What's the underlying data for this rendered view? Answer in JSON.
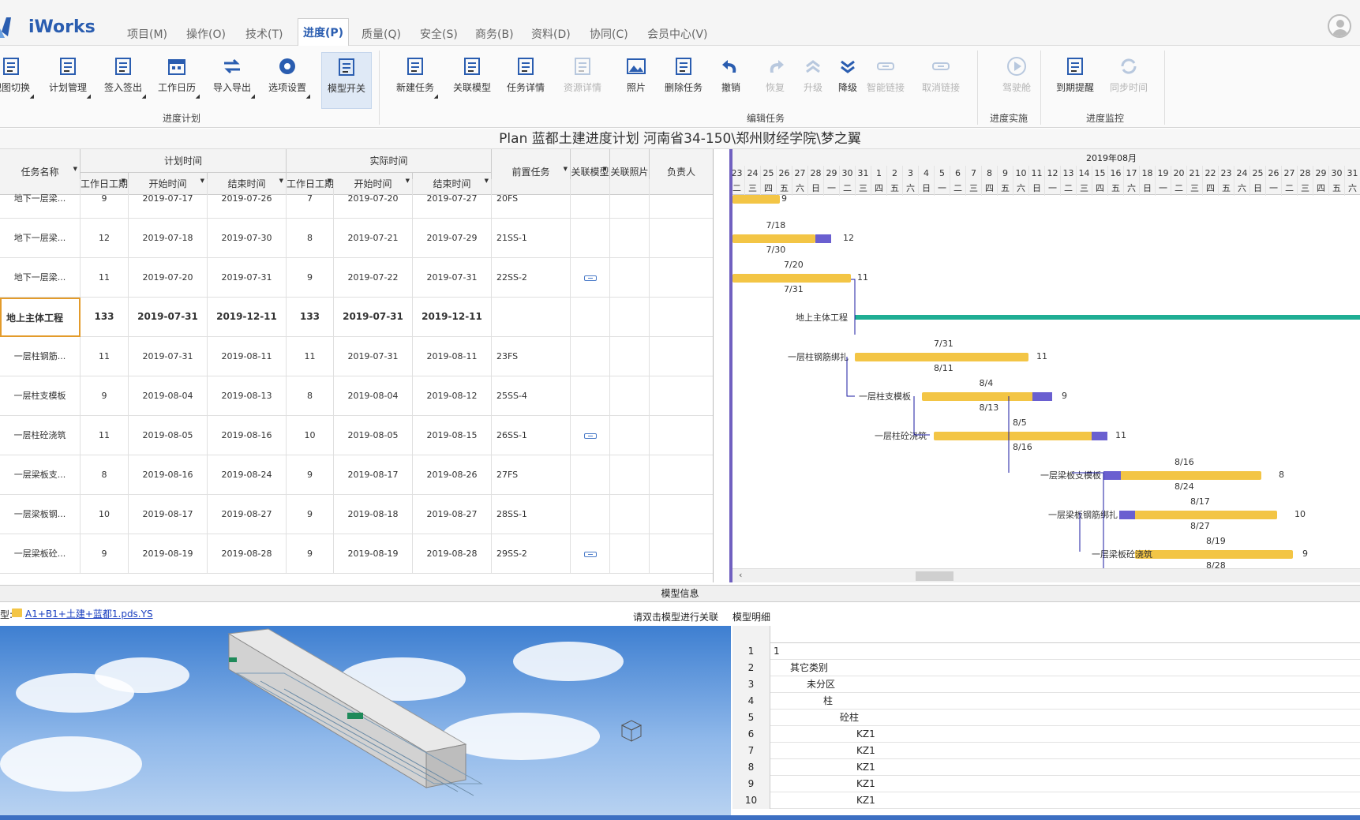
{
  "app": {
    "name": "iWorks"
  },
  "menu": [
    {
      "label": "项目(M)",
      "active": false
    },
    {
      "label": "操作(O)",
      "active": false
    },
    {
      "label": "技术(T)",
      "active": false
    },
    {
      "label": "进度(P)",
      "active": true
    },
    {
      "label": "质量(Q)",
      "active": false
    },
    {
      "label": "安全(S)",
      "active": false
    },
    {
      "label": "商务(B)",
      "active": false
    },
    {
      "label": "资料(D)",
      "active": false
    },
    {
      "label": "协同(C)",
      "active": false
    },
    {
      "label": "会员中心(V)",
      "active": false
    }
  ],
  "ribbon": {
    "groups": [
      {
        "label": "进度计划",
        "buttons": [
          {
            "label": "视图切换",
            "icon": "view-switch-icon",
            "enabled": true,
            "dropdown": true
          },
          {
            "label": "计划管理",
            "icon": "plan-manage-icon",
            "enabled": true,
            "dropdown": true
          },
          {
            "label": "签入签出",
            "icon": "checkin-icon",
            "enabled": true,
            "dropdown": true
          },
          {
            "label": "工作日历",
            "icon": "calendar-icon",
            "enabled": true,
            "dropdown": true
          },
          {
            "label": "导入导出",
            "icon": "import-export-icon",
            "enabled": true,
            "dropdown": true
          },
          {
            "label": "选项设置",
            "icon": "gear-icon",
            "enabled": true,
            "dropdown": true
          },
          {
            "label": "模型开关",
            "icon": "model-switch-icon",
            "enabled": true,
            "dropdown": false,
            "pressed": true
          }
        ]
      },
      {
        "label": "编辑任务",
        "buttons": [
          {
            "label": "新建任务",
            "icon": "new-task-icon",
            "enabled": true,
            "dropdown": true
          },
          {
            "label": "关联模型",
            "icon": "link-model-icon",
            "enabled": true,
            "dropdown": false
          },
          {
            "label": "任务详情",
            "icon": "task-detail-icon",
            "enabled": true,
            "dropdown": false
          },
          {
            "label": "资源详情",
            "icon": "resource-detail-icon",
            "enabled": false,
            "dropdown": false
          },
          {
            "label": "照片",
            "icon": "photo-icon",
            "enabled": true,
            "dropdown": false
          },
          {
            "label": "删除任务",
            "icon": "delete-task-icon",
            "enabled": true,
            "dropdown": false
          },
          {
            "label": "撤销",
            "icon": "undo-icon",
            "enabled": true,
            "dropdown": false
          },
          {
            "label": "恢复",
            "icon": "redo-icon",
            "enabled": false,
            "dropdown": false
          },
          {
            "label": "升级",
            "icon": "upgrade-icon",
            "enabled": false,
            "dropdown": false
          },
          {
            "label": "降级",
            "icon": "downgrade-icon",
            "enabled": true,
            "dropdown": false
          },
          {
            "label": "智能链接",
            "icon": "smart-link-icon",
            "enabled": false,
            "dropdown": false
          },
          {
            "label": "取消链接",
            "icon": "unlink-icon",
            "enabled": false,
            "dropdown": false
          }
        ]
      },
      {
        "label": "进度实施",
        "buttons": [
          {
            "label": "驾驶舱",
            "icon": "play-icon",
            "enabled": false,
            "dropdown": false
          }
        ]
      },
      {
        "label": "进度监控",
        "buttons": [
          {
            "label": "到期提醒",
            "icon": "reminder-icon",
            "enabled": true,
            "dropdown": false
          },
          {
            "label": "同步时间",
            "icon": "sync-icon",
            "enabled": false,
            "dropdown": false
          }
        ]
      }
    ]
  },
  "plan_title": "Plan 蓝都土建进度计划 河南省34-150\\郑州财经学院\\梦之翼",
  "grid": {
    "headers": {
      "task_name": "任务名称",
      "plan_group": "计划时间",
      "actual_group": "实际时间",
      "workdays": "工作日工期",
      "start": "开始时间",
      "end": "结束时间",
      "predecessor": "前置任务",
      "linked_model": "关联模型",
      "linked_photo": "关联照片",
      "owner": "负责人"
    },
    "rows": [
      {
        "name": "地下一层梁...",
        "plan_days": "9",
        "plan_start": "2019-07-17",
        "plan_end": "2019-07-26",
        "act_days": "7",
        "act_start": "2019-07-20",
        "act_end": "2019-07-27",
        "pred": "20FS",
        "model": false,
        "bold": false
      },
      {
        "name": "地下一层梁...",
        "plan_days": "12",
        "plan_start": "2019-07-18",
        "plan_end": "2019-07-30",
        "act_days": "8",
        "act_start": "2019-07-21",
        "act_end": "2019-07-29",
        "pred": "21SS-1",
        "model": false,
        "bold": false
      },
      {
        "name": "地下一层梁...",
        "plan_days": "11",
        "plan_start": "2019-07-20",
        "plan_end": "2019-07-31",
        "act_days": "9",
        "act_start": "2019-07-22",
        "act_end": "2019-07-31",
        "pred": "22SS-2",
        "model": true,
        "bold": false
      },
      {
        "name": "地上主体工程",
        "plan_days": "133",
        "plan_start": "2019-07-31",
        "plan_end": "2019-12-11",
        "act_days": "133",
        "act_start": "2019-07-31",
        "act_end": "2019-12-11",
        "pred": "",
        "model": false,
        "bold": true
      },
      {
        "name": "一层柱钢筋...",
        "plan_days": "11",
        "plan_start": "2019-07-31",
        "plan_end": "2019-08-11",
        "act_days": "11",
        "act_start": "2019-07-31",
        "act_end": "2019-08-11",
        "pred": "23FS",
        "model": false,
        "bold": false
      },
      {
        "name": "一层柱支模板",
        "plan_days": "9",
        "plan_start": "2019-08-04",
        "plan_end": "2019-08-13",
        "act_days": "8",
        "act_start": "2019-08-04",
        "act_end": "2019-08-12",
        "pred": "25SS-4",
        "model": false,
        "bold": false
      },
      {
        "name": "一层柱砼浇筑",
        "plan_days": "11",
        "plan_start": "2019-08-05",
        "plan_end": "2019-08-16",
        "act_days": "10",
        "act_start": "2019-08-05",
        "act_end": "2019-08-15",
        "pred": "26SS-1",
        "model": true,
        "bold": false
      },
      {
        "name": "一层梁板支...",
        "plan_days": "8",
        "plan_start": "2019-08-16",
        "plan_end": "2019-08-24",
        "act_days": "9",
        "act_start": "2019-08-17",
        "act_end": "2019-08-26",
        "pred": "27FS",
        "model": false,
        "bold": false
      },
      {
        "name": "一层梁板钢...",
        "plan_days": "10",
        "plan_start": "2019-08-17",
        "plan_end": "2019-08-27",
        "act_days": "9",
        "act_start": "2019-08-18",
        "act_end": "2019-08-27",
        "pred": "28SS-1",
        "model": false,
        "bold": false
      },
      {
        "name": "一层梁板砼...",
        "plan_days": "9",
        "plan_start": "2019-08-19",
        "plan_end": "2019-08-28",
        "act_days": "9",
        "act_start": "2019-08-19",
        "act_end": "2019-08-28",
        "pred": "29SS-2",
        "model": true,
        "bold": false
      }
    ]
  },
  "gantt": {
    "month": "2019年08月",
    "days": [
      "23",
      "24",
      "25",
      "26",
      "27",
      "28",
      "29",
      "30",
      "31",
      "1",
      "2",
      "3",
      "4",
      "5",
      "6",
      "7",
      "8",
      "9",
      "10",
      "11",
      "12",
      "13",
      "14",
      "15",
      "16",
      "17",
      "18",
      "19",
      "20",
      "21",
      "22",
      "23",
      "24",
      "25",
      "26",
      "27",
      "28",
      "29",
      "30",
      "31"
    ],
    "weekdays": [
      "二",
      "三",
      "四",
      "五",
      "六",
      "日",
      "一",
      "二",
      "三",
      "四",
      "五",
      "六",
      "日",
      "一",
      "二",
      "三",
      "四",
      "五",
      "六",
      "日",
      "一",
      "二",
      "三",
      "四",
      "五",
      "六",
      "日",
      "一",
      "二",
      "三",
      "四",
      "五",
      "六",
      "日",
      "一",
      "二",
      "三",
      "四",
      "五",
      "六"
    ],
    "bars": [
      {
        "label": "",
        "dur": "9",
        "start_date": "",
        "end_date": ""
      },
      {
        "label": "",
        "dur": "12",
        "start_date": "7/18",
        "end_date": "7/30"
      },
      {
        "label": "",
        "dur": "11",
        "start_date": "7/20",
        "end_date": "7/31"
      },
      {
        "label": "地上主体工程",
        "dur": "",
        "start_date": "",
        "end_date": ""
      },
      {
        "label": "一层柱钢筋绑扎",
        "dur": "11",
        "start_date": "7/31",
        "end_date": "8/11"
      },
      {
        "label": "一层柱支模板",
        "dur": "9",
        "start_date": "8/4",
        "end_date": "8/13"
      },
      {
        "label": "一层柱砼浇筑",
        "dur": "11",
        "start_date": "8/5",
        "end_date": "8/16"
      },
      {
        "label": "一层梁板支模板",
        "dur": "8",
        "start_date": "8/16",
        "end_date": "8/24"
      },
      {
        "label": "一层梁板钢筋绑扎",
        "dur": "10",
        "start_date": "8/17",
        "end_date": "8/27"
      },
      {
        "label": "一层梁板砼浇筑",
        "dur": "9",
        "start_date": "8/19",
        "end_date": "8/28"
      }
    ]
  },
  "model_panel": {
    "title": "模型信息",
    "file_prefix": "型:",
    "file_name": "A1+B1+土建+蓝都1.pds.YS",
    "hint": "请双击模型进行关联",
    "detail_tab": "模型明细"
  },
  "detail_table": {
    "rows": [
      {
        "n": "1",
        "text": "1",
        "indent": 0
      },
      {
        "n": "2",
        "text": "其它类别",
        "indent": 1
      },
      {
        "n": "3",
        "text": "未分区",
        "indent": 2
      },
      {
        "n": "4",
        "text": "柱",
        "indent": 3
      },
      {
        "n": "5",
        "text": "砼柱",
        "indent": 4
      },
      {
        "n": "6",
        "text": "KZ1",
        "indent": 5
      },
      {
        "n": "7",
        "text": "KZ1",
        "indent": 5
      },
      {
        "n": "8",
        "text": "KZ1",
        "indent": 5
      },
      {
        "n": "9",
        "text": "KZ1",
        "indent": 5
      },
      {
        "n": "10",
        "text": "KZ1",
        "indent": 5
      }
    ]
  },
  "colors": {
    "accent": "#2a5db0",
    "bar_plan": "#f3c545",
    "bar_progress": "#6a5fd0",
    "summary_bar": "#1fae94"
  }
}
